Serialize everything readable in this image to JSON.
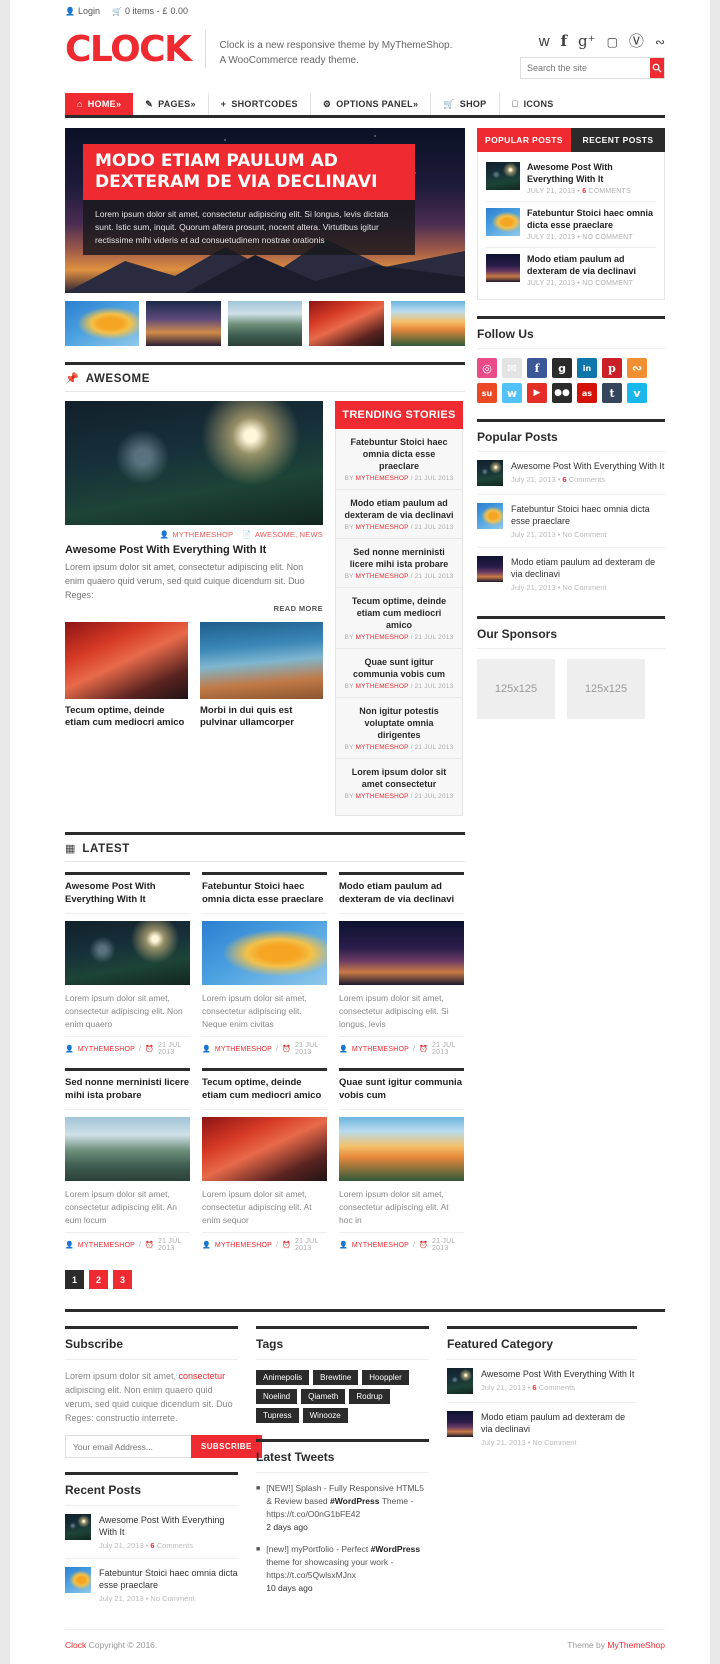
{
  "topbar": {
    "login": "Login",
    "cart": "0 items -",
    "currency": "£",
    "amount": "0.00"
  },
  "header": {
    "logo": "CLOCK",
    "tagline_line1": "Clock is a new responsive theme by MyThemeShop.",
    "tagline_line2": "A WooCommerce ready theme.",
    "search_placeholder": "Search the site",
    "social": [
      "twitter",
      "facebook",
      "google-plus",
      "youtube",
      "pinterest",
      "rss"
    ]
  },
  "nav": [
    {
      "label": "HOME»",
      "icon": "home-icon",
      "active": true
    },
    {
      "label": "PAGES»",
      "icon": "pages-icon",
      "active": false
    },
    {
      "label": "SHORTCODES",
      "icon": "plus-icon",
      "active": false
    },
    {
      "label": "OPTIONS PANEL»",
      "icon": "options-icon",
      "active": false
    },
    {
      "label": "SHOP",
      "icon": "cart-icon",
      "active": false
    },
    {
      "label": "ICONS",
      "icon": "apple-icon",
      "active": false
    }
  ],
  "slider": {
    "title": "MODO ETIAM PAULUM AD DEXTERAM DE VIA DECLINAVI",
    "text": "Lorem ipsum dolor sit amet, consectetur adipiscing elit. Si longus, levis dictata sunt. Istic sum, inquit. Quorum altera prosunt, nocent altera. Virtutibus igitur rectissime mihi videris et ad consuetudinem nostrae orationis",
    "thumbs": [
      "img-leaf",
      "img-sunset",
      "img-river",
      "img-red",
      "img-fall"
    ]
  },
  "awesome": {
    "heading": "AWESOME",
    "heading_icon": "pin-icon",
    "featured": {
      "image": "img-park",
      "author": "MYTHEMESHOP",
      "categories": "AWESOME, NEWS",
      "title": "Awesome Post With Everything With It",
      "excerpt": "Lorem ipsum dolor sit amet, consectetur adipiscing elit. Non enim quaero quid verum, sed quid cuique dicendum sit. Duo Reges:",
      "readmore": "READ MORE"
    },
    "sub": [
      {
        "image": "img-red",
        "title": "Tecum optime, deinde etiam cum mediocri amico"
      },
      {
        "image": "img-blue",
        "title": "Morbi in dui quis est pulvinar ullamcorper"
      }
    ]
  },
  "trending": {
    "heading": "TRENDING STORIES",
    "items": [
      {
        "title": "Fatebuntur Stoici haec omnia dicta esse praeclare",
        "by": "BY",
        "author": "MYTHEMESHOP",
        "date": "/ 21 JUL 2013"
      },
      {
        "title": "Modo etiam paulum ad dexteram de via declinavi",
        "by": "BY",
        "author": "MYTHEMESHOP",
        "date": "/ 21 JUL 2013"
      },
      {
        "title": "Sed nonne merninisti licere mihi ista probare",
        "by": "BY",
        "author": "MYTHEMESHOP",
        "date": "/ 21 JUL 2013"
      },
      {
        "title": "Tecum optime, deinde etiam cum mediocri amico",
        "by": "BY",
        "author": "MYTHEMESHOP",
        "date": "/ 21 JUL 2013"
      },
      {
        "title": "Quae sunt igitur communia vobis cum",
        "by": "BY",
        "author": "MYTHEMESHOP",
        "date": "/ 21 JUL 2013"
      },
      {
        "title": "Non igitur potestis voluptate omnia dirigentes",
        "by": "BY",
        "author": "MYTHEMESHOP",
        "date": "/ 21 JUL 2013"
      },
      {
        "title": "Lorem ipsum dolor sit amet consectetur",
        "by": "BY",
        "author": "MYTHEMESHOP",
        "date": "/ 21 JUL 2013"
      }
    ]
  },
  "latest": {
    "heading": "LATEST",
    "heading_icon": "grid-icon",
    "cards": [
      {
        "title": "Awesome Post With Everything With It",
        "image": "img-park",
        "excerpt": "Lorem ipsum dolor sit amet, consectetur adipiscing elit. Non enim quaero",
        "author": "MYTHEMESHOP",
        "date": "21 JUL 2013"
      },
      {
        "title": "Fatebuntur Stoici haec omnia dicta esse praeclare",
        "image": "img-leaf",
        "excerpt": "Lorem ipsum dolor sit amet, consectetur adipiscing elit. Neque enim civitas",
        "author": "MYTHEMESHOP",
        "date": "21 JUL 2013"
      },
      {
        "title": "Modo etiam paulum ad dexteram de via declinavi",
        "image": "img-matter",
        "excerpt": "Lorem ipsum dolor sit amet, consectetur adipiscing elit. Si longus, levis",
        "author": "MYTHEMESHOP",
        "date": "21 JUL 2013"
      },
      {
        "title": "Sed nonne merninisti licere mihi ista probare",
        "image": "img-river",
        "excerpt": "Lorem ipsum dolor sit amet, consectetur adipiscing elit. An eum locum",
        "author": "MYTHEMESHOP",
        "date": "21 JUL 2013"
      },
      {
        "title": "Tecum optime, deinde etiam cum mediocri amico",
        "image": "img-red",
        "excerpt": "Lorem ipsum dolor sit amet, consectetur adipiscing elit. At enim sequor",
        "author": "MYTHEMESHOP",
        "date": "21 JUL 2013"
      },
      {
        "title": "Quae sunt igitur communia vobis cum",
        "image": "img-fall",
        "excerpt": "Lorem ipsum dolor sit amet, consectetur adipiscing elit. At hoc in",
        "author": "MYTHEMESHOP",
        "date": "21 JUL 2013"
      }
    ],
    "pagination": [
      "1",
      "2",
      "3"
    ],
    "current_page": "1"
  },
  "sidebar": {
    "tabs": [
      {
        "label": "POPULAR POSTS",
        "active": true
      },
      {
        "label": "RECENT POSTS",
        "active": false
      }
    ],
    "tab_posts": [
      {
        "image": "img-park",
        "title": "Awesome Post With Everything With It",
        "date": "JULY 21, 2013 •",
        "comments": "6",
        "comments_label": "COMMENTS"
      },
      {
        "image": "img-leaf",
        "title": "Fatebuntur Stoici haec omnia dicta esse praeclare",
        "date": "JULY 21, 2013 • NO COMMENT",
        "comments": "",
        "comments_label": ""
      },
      {
        "image": "img-matter",
        "title": "Modo etiam paulum ad dexteram de via declinavi",
        "date": "JULY 21, 2013 • NO COMMENT",
        "comments": "",
        "comments_label": ""
      }
    ],
    "follow_heading": "Follow Us",
    "follow_icons": [
      {
        "name": "dribbble-icon",
        "glyph": "◉",
        "color": "#ea4c89"
      },
      {
        "name": "email-icon",
        "glyph": "✉",
        "color": "#e3e3e3"
      },
      {
        "name": "facebook-icon",
        "glyph": "f",
        "color": "#3b5998"
      },
      {
        "name": "google-plus-icon",
        "glyph": "g",
        "color": "#2b2b2b"
      },
      {
        "name": "linkedin-icon",
        "glyph": "in",
        "color": "#0e76a8"
      },
      {
        "name": "pinterest-icon",
        "glyph": "p",
        "color": "#cb2027"
      },
      {
        "name": "rss-icon",
        "glyph": "≈",
        "color": "#f09033"
      },
      {
        "name": "stumbleupon-icon",
        "glyph": "su",
        "color": "#eb4924"
      },
      {
        "name": "twitter-icon",
        "glyph": "t",
        "color": "#4fc3f7"
      },
      {
        "name": "youtube-icon",
        "glyph": "▶",
        "color": "#e52d27"
      },
      {
        "name": "flickr-icon",
        "glyph": "••",
        "color": "#2b2b2b"
      },
      {
        "name": "lastfm-icon",
        "glyph": "as",
        "color": "#d51007"
      },
      {
        "name": "tumblr-icon",
        "glyph": "t",
        "color": "#35465c"
      },
      {
        "name": "vimeo-icon",
        "glyph": "v",
        "color": "#1ab7ea"
      }
    ],
    "popular_heading": "Popular Posts",
    "popular_posts": [
      {
        "image": "img-park",
        "title": "Awesome Post With Everything With It",
        "date": "July 21, 2013 •",
        "comments": "6",
        "comments_label": "Comments"
      },
      {
        "image": "img-leaf",
        "title": "Fatebuntur Stoici haec omnia dicta esse praeclare",
        "date": "July 21, 2013 • No Comment",
        "comments": "",
        "comments_label": ""
      },
      {
        "image": "img-matter",
        "title": "Modo etiam paulum ad dexteram de via declinavi",
        "date": "July 21, 2013 • No Comment",
        "comments": "",
        "comments_label": ""
      }
    ],
    "sponsors_heading": "Our Sponsors",
    "sponsors": [
      "125x125",
      "125x125"
    ]
  },
  "footer": {
    "subscribe": {
      "heading": "Subscribe",
      "text_before": "Lorem ipsum dolor sit amet, ",
      "link": "consectetur",
      "text_after": " adipiscing elit. Non enim quaero quid verum, sed quid cuique dicendum sit. Duo Reges: constructio interrete.",
      "placeholder": "Your email Address...",
      "button": "SUBSCRIBE"
    },
    "recent": {
      "heading": "Recent Posts",
      "posts": [
        {
          "image": "img-park",
          "title": "Awesome Post With Everything With It",
          "date": "July 21, 2013 •",
          "comments": "6",
          "comments_label": "Comments"
        },
        {
          "image": "img-leaf",
          "title": "Fatebuntur Stoici haec omnia dicta esse praeclare",
          "date": "July 21, 2013 • No Comment",
          "comments": "",
          "comments_label": ""
        }
      ]
    },
    "tags": {
      "heading": "Tags",
      "items": [
        "Animepolis",
        "Brewtine",
        "Hooppler",
        "Noelind",
        "Qiameth",
        "Rodrup",
        "Tupress",
        "Winooze"
      ]
    },
    "tweets": {
      "heading": "Latest Tweets",
      "items": [
        {
          "text": "[NEW!] Splash - Fully Responsive HTML5 & Review based ",
          "hash": "#WordPress",
          "text2": " Theme - https://t.co/O0nG1bFE42",
          "ago": "2 days ago"
        },
        {
          "text": "[new!] myPortfolio - Perfect ",
          "hash": "#WordPress",
          "text2": " theme for showcasing your work - https://t.co/5QwlsxMJnx",
          "ago": "10 days ago"
        }
      ]
    },
    "featured": {
      "heading": "Featured Category",
      "posts": [
        {
          "image": "img-park",
          "title": "Awesome Post With Everything With It",
          "date": "July 21, 2013 •",
          "comments": "6",
          "comments_label": "Comments"
        },
        {
          "image": "img-matter",
          "title": "Modo etiam paulum ad dexteram de via declinavi",
          "date": "July 21, 2013 • No Comment",
          "comments": "",
          "comments_label": ""
        }
      ]
    }
  },
  "copyright": {
    "brand": "Clock",
    "text": "Copyright © 2016.",
    "theme_by": "Theme by",
    "theme_link": "MyThemeShop"
  }
}
